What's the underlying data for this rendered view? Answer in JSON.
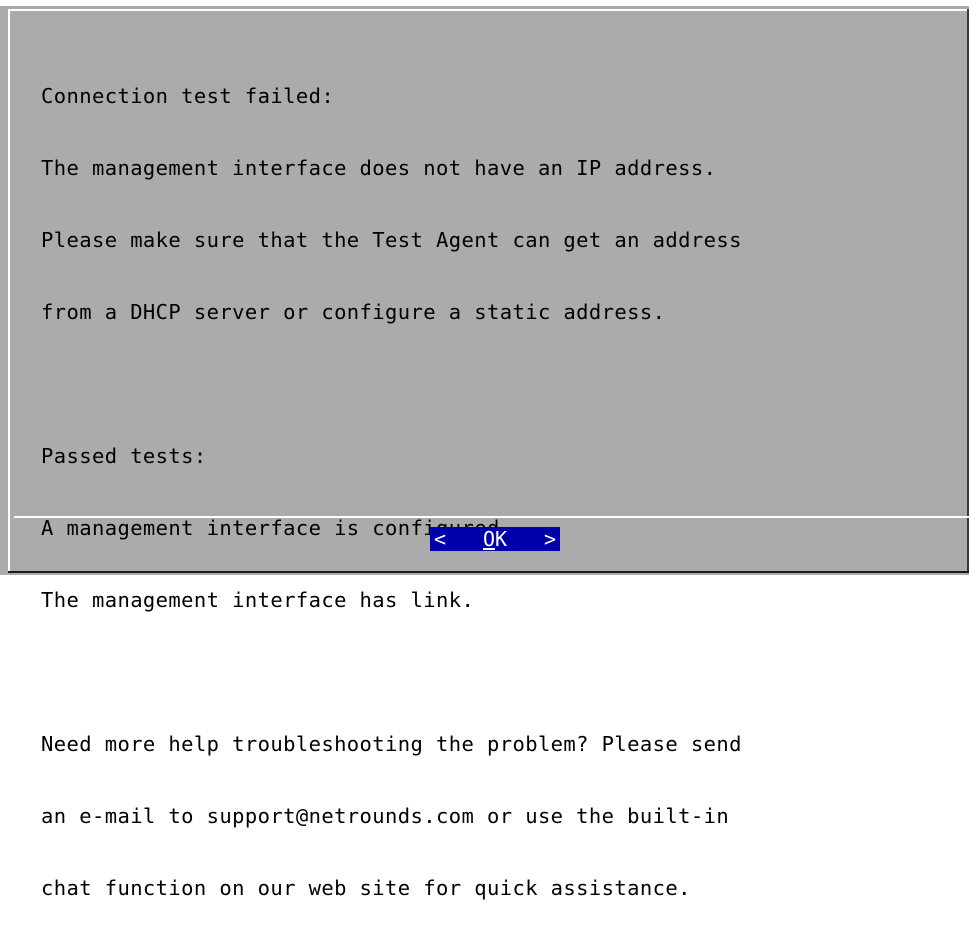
{
  "dialog": {
    "message_lines": [
      "Connection test failed:",
      "The management interface does not have an IP address.",
      "Please make sure that the Test Agent can get an address",
      "from a DHCP server or configure a static address.",
      "",
      "Passed tests:",
      "A management interface is configured.",
      "The management interface has link.",
      "",
      "Need more help troubleshooting the problem? Please send",
      "an e-mail to support@netrounds.com or use the built-in",
      "chat function on our web site for quick assistance."
    ]
  },
  "ok_button": {
    "left_bracket": "<",
    "hotkey": "O",
    "rest_label": "K",
    "right_bracket": ">",
    "color": "#0000aa"
  },
  "colors": {
    "background": "#ababab",
    "text": "#000000",
    "highlight_text": "#ffffff"
  }
}
